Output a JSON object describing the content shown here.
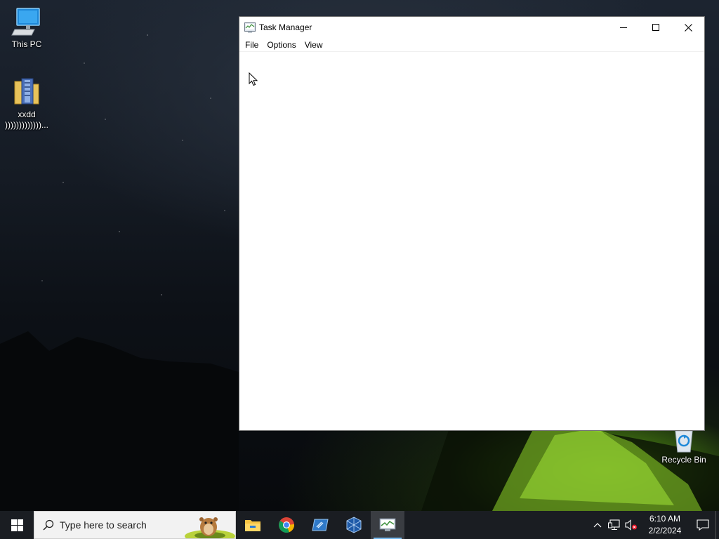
{
  "desktop": {
    "icons": [
      {
        "label": "This PC",
        "icon": "computer-icon"
      },
      {
        "label": "xxdd",
        "label_line2": ")))))))))))))...",
        "icon": "archive-folder-icon"
      },
      {
        "label": "Recycle Bin",
        "icon": "recycle-bin-icon"
      }
    ]
  },
  "window": {
    "title": "Task Manager",
    "app_icon": "task-manager-icon",
    "controls": [
      "minimize-icon",
      "maximize-icon",
      "close-icon"
    ],
    "menu": [
      "File",
      "Options",
      "View"
    ]
  },
  "taskbar": {
    "search_placeholder": "Type here to search",
    "apps": [
      {
        "name": "file-explorer-icon",
        "active": false
      },
      {
        "name": "chrome-icon",
        "active": false
      },
      {
        "name": "generic-app-icon",
        "active": false
      },
      {
        "name": "virtualbox-icon",
        "active": false
      },
      {
        "name": "task-manager-icon",
        "active": true
      }
    ],
    "tray": {
      "icons": [
        "chevron-up-icon",
        "network-icon",
        "volume-muted-icon"
      ],
      "time": "6:10 AM",
      "date": "2/2/2024"
    }
  },
  "colors": {
    "taskbar_bg": "#1a1d22",
    "accent": "#76b9ed",
    "window_bg": "#ffffff"
  }
}
